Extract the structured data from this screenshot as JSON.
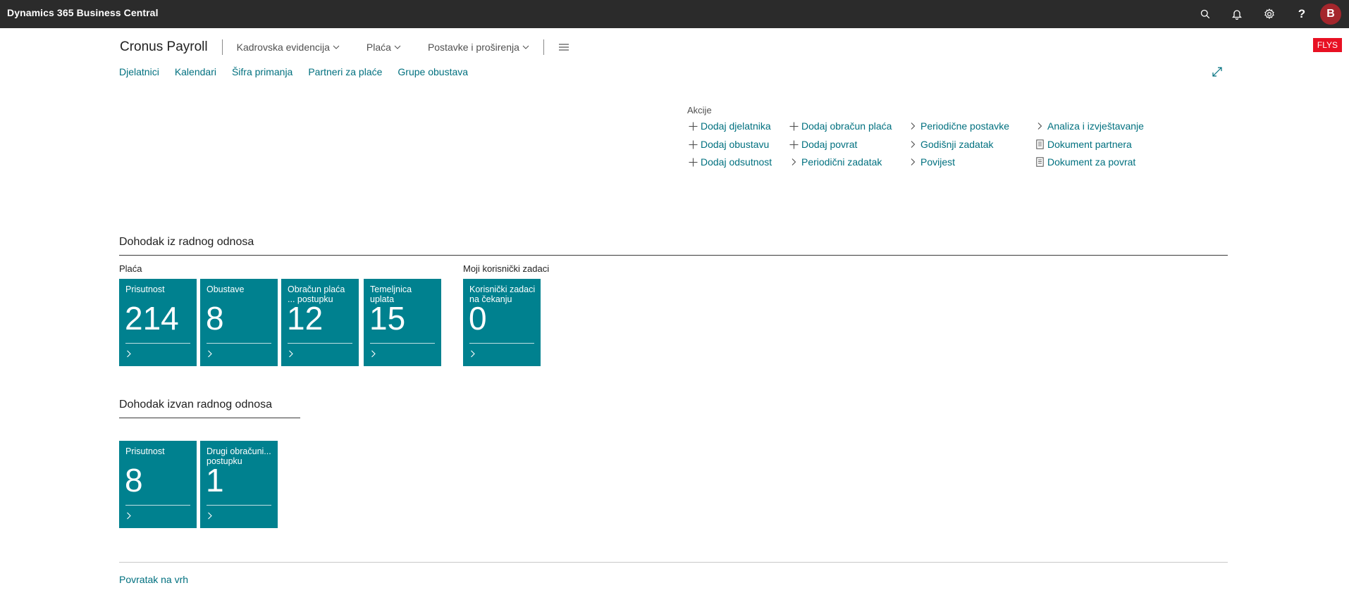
{
  "app": {
    "title": "Dynamics 365 Business Central",
    "avatar_initial": "B",
    "env_badge": "FLYS",
    "icons": [
      "search-icon",
      "bell-icon",
      "gear-icon",
      "help-icon"
    ]
  },
  "nav": {
    "company": "Cronus Payroll",
    "menus": [
      {
        "label": "Kadrovska evidencija"
      },
      {
        "label": "Plaća"
      },
      {
        "label": "Postavke i proširenja"
      }
    ],
    "links": [
      {
        "label": "Djelatnici"
      },
      {
        "label": "Kalendari"
      },
      {
        "label": "Šifra primanja"
      },
      {
        "label": "Partneri za plaće"
      },
      {
        "label": "Grupe obustava"
      }
    ]
  },
  "actions": {
    "title": "Akcije",
    "items": [
      {
        "label": "Dodaj djelatnika",
        "icon": "plus-icon"
      },
      {
        "label": "Dodaj obustavu",
        "icon": "plus-icon"
      },
      {
        "label": "Dodaj odsutnost",
        "icon": "plus-icon"
      },
      {
        "label": "Dodaj obračun plaća",
        "icon": "plus-icon"
      },
      {
        "label": "Dodaj povrat",
        "icon": "plus-icon"
      },
      {
        "label": "Periodični zadatak",
        "icon": "chevron-right-icon"
      },
      {
        "label": "Periodične postavke",
        "icon": "chevron-right-icon"
      },
      {
        "label": "Godišnji zadatak",
        "icon": "chevron-right-icon"
      },
      {
        "label": "Povijest",
        "icon": "chevron-right-icon"
      },
      {
        "label": "Analiza i izvještavanje",
        "icon": "chevron-right-icon"
      },
      {
        "label": "Dokument partnera",
        "icon": "document-icon"
      },
      {
        "label": "Dokument za povrat",
        "icon": "document-icon"
      }
    ]
  },
  "sections": [
    {
      "title": "Dohodak iz radnog odnosa",
      "groups": [
        {
          "title": "Plaća",
          "tiles": [
            {
              "label": "Prisutnost",
              "value": "214"
            },
            {
              "label": "Obustave",
              "value": "8"
            },
            {
              "label": "Obračun plaća ... postupku",
              "value": "12"
            },
            {
              "label": "Temeljnica uplata",
              "value": "15"
            }
          ]
        },
        {
          "title": "Moji korisnički zadaci",
          "tiles": [
            {
              "label": "Korisnički zadaci na čekanju",
              "value": "0"
            }
          ]
        }
      ]
    },
    {
      "title": "Dohodak izvan radnog odnosa",
      "groups": [
        {
          "title": "",
          "tiles": [
            {
              "label": "Prisutnost",
              "value": "8"
            },
            {
              "label": "Drugi obračuni... postupku",
              "value": "1"
            }
          ]
        }
      ]
    }
  ],
  "footer": {
    "back_to_top": "Povratak na vrh"
  },
  "colors": {
    "tile": "#00818f",
    "link": "#00707f",
    "topbar": "#2b2b2b",
    "avatar": "#a4262c",
    "badge": "#e81123"
  }
}
